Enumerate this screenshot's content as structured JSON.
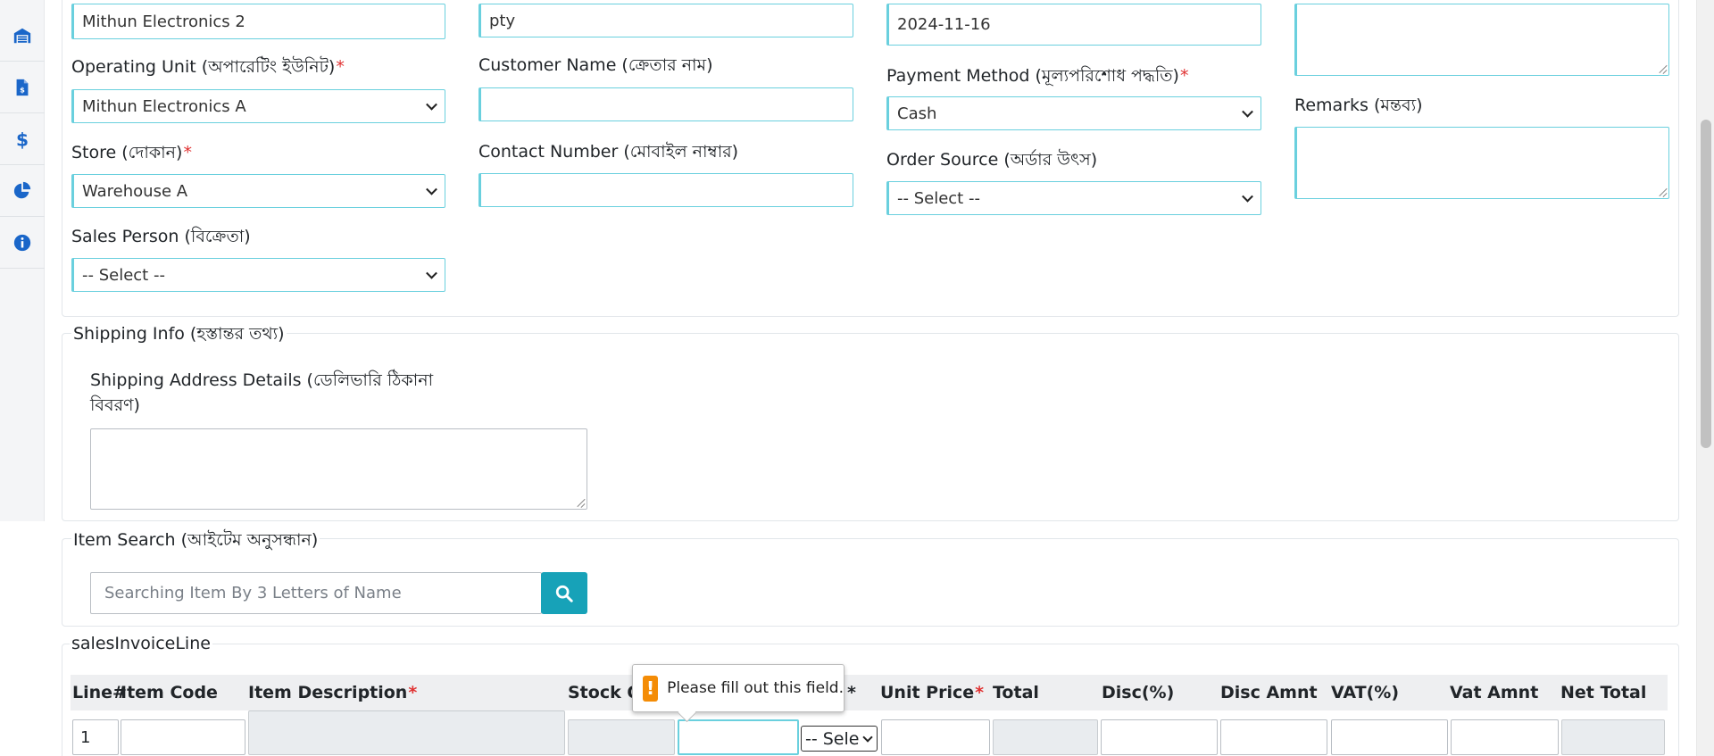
{
  "sidebar": {
    "items": [
      {
        "icon": "warehouse-icon"
      },
      {
        "icon": "invoice-icon"
      },
      {
        "icon": "dollar-icon"
      },
      {
        "icon": "pie-chart-icon"
      },
      {
        "icon": "info-icon"
      }
    ]
  },
  "form": {
    "col1": {
      "top_value": "Mithun Electronics 2",
      "operating_unit_label": "Operating Unit (অপারেটিং ইউনিট)",
      "operating_unit_value": "Mithun Electronics A",
      "store_label": "Store (দোকান)",
      "store_value": "Warehouse A",
      "sales_person_label": "Sales Person (বিক্রেতা)",
      "sales_person_value": "-- Select --"
    },
    "col2": {
      "top_value": "pty",
      "customer_name_label": "Customer Name (ক্রেতার নাম)",
      "customer_name_value": "",
      "contact_number_label": "Contact Number (মোবাইল নাম্বার)",
      "contact_number_value": ""
    },
    "col3": {
      "top_value": "2024-11-16",
      "payment_method_label": "Payment Method (মূল্যপরিশোধ পদ্ধতি)",
      "payment_method_value": "Cash",
      "order_source_label": "Order Source (অর্ডার উৎস)",
      "order_source_value": "-- Select --"
    },
    "col4": {
      "remarks_label": "Remarks (মন্তব্য)"
    },
    "required_mark": "*"
  },
  "shipping": {
    "legend": "Shipping Info (হস্তান্তর তথ্য)",
    "address_label": "Shipping Address Details (ডেলিভারি ঠিকানা বিবরণ)"
  },
  "item_search": {
    "legend": "Item Search (আইটেম অনুসন্ধান)",
    "placeholder": "Searching Item By 3 Letters of Name"
  },
  "invoice_lines": {
    "legend": "salesInvoiceLine",
    "headers": {
      "line": "Line#",
      "item_code": "Item Code",
      "item_description": "Item Description",
      "stock_qty": "Stock Q",
      "qty_required": "*",
      "unit_price": "Unit Price",
      "total": "Total",
      "disc_pct": "Disc(%)",
      "disc_amnt": "Disc Amnt",
      "vat_pct": "VAT(%)",
      "vat_amnt": "Vat Amnt",
      "net_total": "Net Total"
    },
    "row": {
      "line_no": "1",
      "unit_select": "-- Sele"
    }
  },
  "tooltip": {
    "icon": "!",
    "message": "Please fill out this field."
  },
  "colors": {
    "accent": "#17a2b8",
    "input_border": "#6ad0de",
    "required": "#e03131",
    "warning": "#f48c06"
  }
}
